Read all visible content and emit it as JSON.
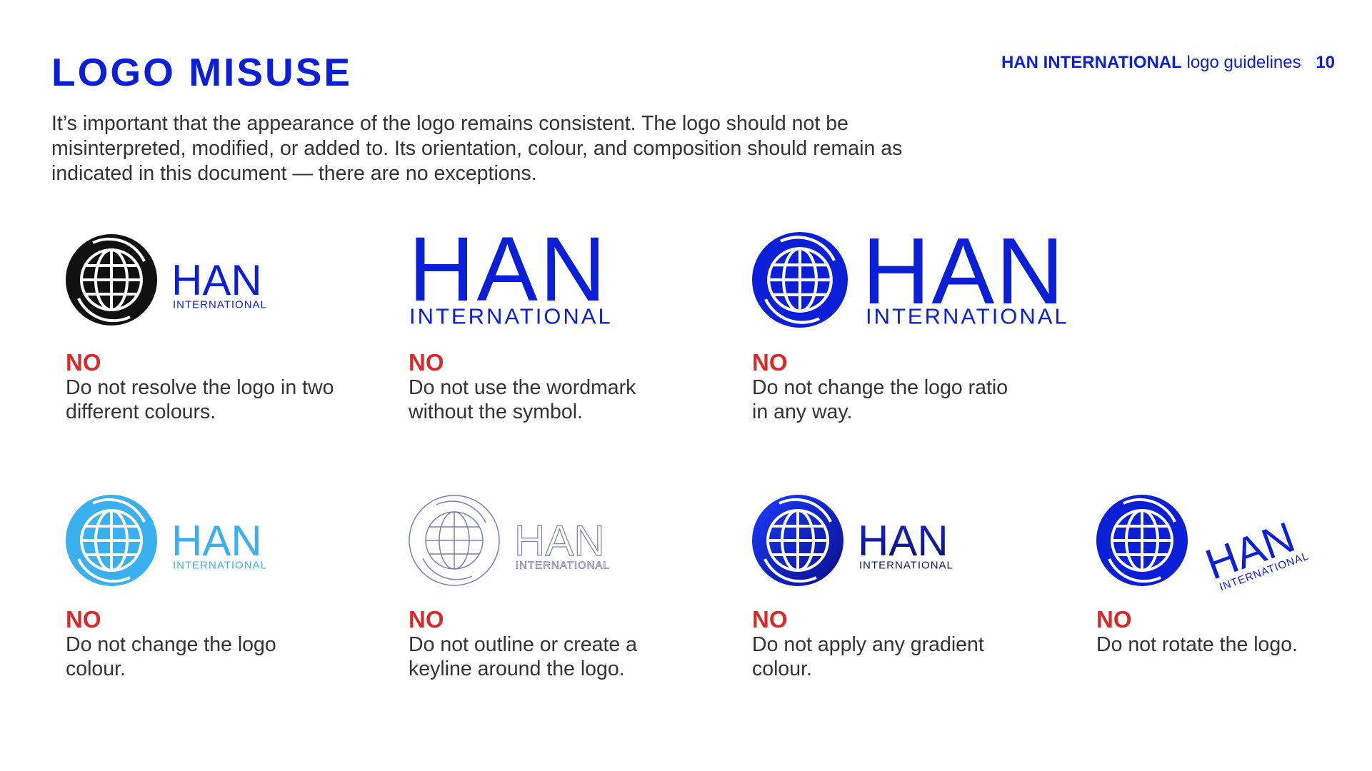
{
  "header": {
    "title": "LOGO MISUSE",
    "brand": "HAN INTERNATIONAL",
    "section": "logo guidelines",
    "page_number": "10"
  },
  "intro": "It’s important that the appearance of the logo remains consistent. The logo should not be misinterpreted, modified, or added to. Its orientation, colour, and composition should remain as indicated in this document — there are no exceptions.",
  "logo_text": {
    "wordmark": "HAN",
    "subtitle": "INTERNATIONAL"
  },
  "colors": {
    "brand_blue": "#0a1fd6",
    "no_red": "#d62b2b",
    "black": "#111111",
    "light_blue": "#3ab0ee",
    "outline": "#7a7fb8",
    "navy": "#0a1570",
    "text": "#333333"
  },
  "examples": [
    {
      "id": "two-colours",
      "no_label": "NO",
      "description": "Do not resolve the logo in two different colours."
    },
    {
      "id": "wordmark-only",
      "no_label": "NO",
      "description": "Do not use the wordmark without the symbol."
    },
    {
      "id": "ratio",
      "no_label": "NO",
      "description": "Do not change the logo ratio in any way."
    },
    {
      "id": "colour",
      "no_label": "NO",
      "description": "Do not change the logo colour."
    },
    {
      "id": "outline",
      "no_label": "NO",
      "description": "Do not outline or create a keyline around the logo."
    },
    {
      "id": "gradient",
      "no_label": "NO",
      "description": "Do not apply any gradient colour."
    },
    {
      "id": "rotate",
      "no_label": "NO",
      "description": "Do not rotate the logo."
    }
  ]
}
